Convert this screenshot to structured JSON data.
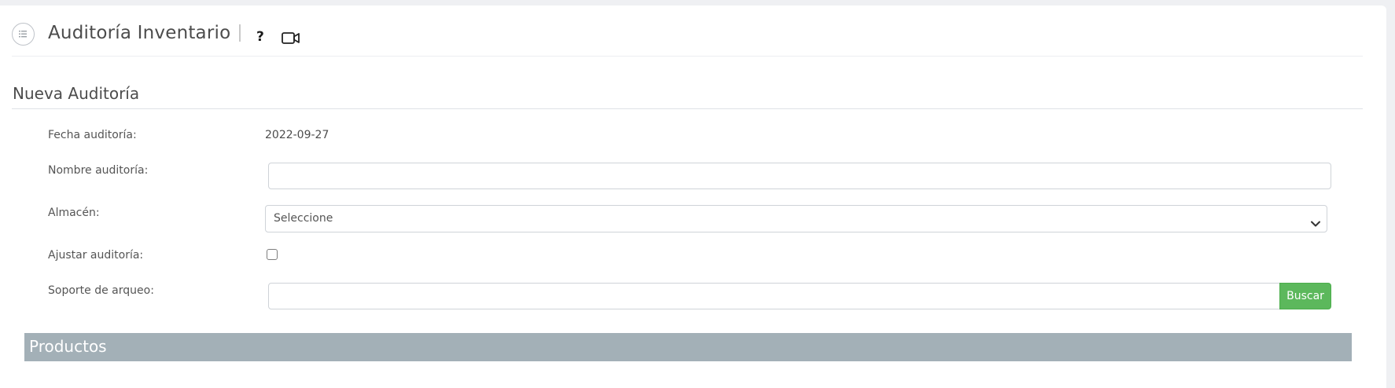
{
  "header": {
    "title": "Auditoría Inventario",
    "help_label": "?",
    "icons": [
      "list-icon",
      "video-icon"
    ]
  },
  "section": {
    "title": "Nueva Auditoría"
  },
  "form": {
    "fecha_label": "Fecha auditoría:",
    "fecha_value": "2022-09-27",
    "nombre_label": "Nombre auditoría:",
    "nombre_value": "",
    "almacen_label": "Almacén:",
    "almacen_selected": "Seleccione",
    "ajustar_label": "Ajustar auditoría:",
    "ajustar_checked": false,
    "soporte_label": "Soporte de arqueo:",
    "soporte_value": "",
    "buscar_label": "Buscar"
  },
  "products": {
    "title": "Productos"
  },
  "colors": {
    "accent_green": "#5cb85c",
    "products_bar": "#a3b0b7"
  }
}
